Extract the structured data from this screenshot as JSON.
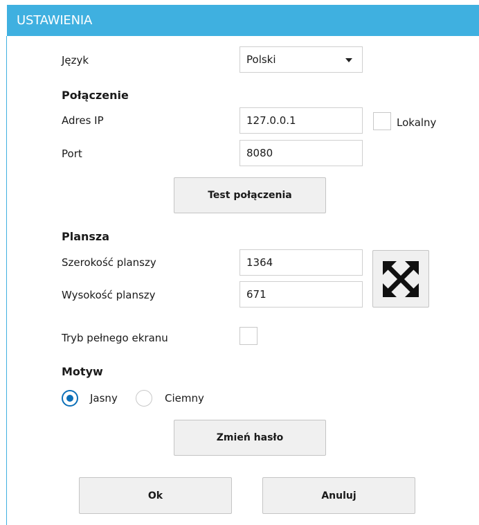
{
  "window": {
    "title": "USTAWIENIA"
  },
  "language": {
    "label": "Język",
    "value": "Polski"
  },
  "connection": {
    "heading": "Połączenie",
    "ip_label": "Adres IP",
    "ip_value": "127.0.0.1",
    "local_label": "Lokalny",
    "local_checked": false,
    "port_label": "Port",
    "port_value": "8080",
    "test_button": "Test połączenia"
  },
  "board": {
    "heading": "Plansza",
    "width_label": "Szerokość planszy",
    "width_value": "1364",
    "height_label": "Wysokość planszy",
    "height_value": "671",
    "maximize_icon": "expand-arrows-icon",
    "fullscreen_label": "Tryb pełnego ekranu",
    "fullscreen_checked": false
  },
  "theme": {
    "heading": "Motyw",
    "options": [
      {
        "label": "Jasny",
        "selected": true
      },
      {
        "label": "Ciemny",
        "selected": false
      }
    ]
  },
  "actions": {
    "change_password": "Zmień hasło",
    "ok": "Ok",
    "cancel": "Anuluj"
  },
  "colors": {
    "titlebar": "#3fb0e0",
    "radio_accent": "#0b6fb8"
  }
}
